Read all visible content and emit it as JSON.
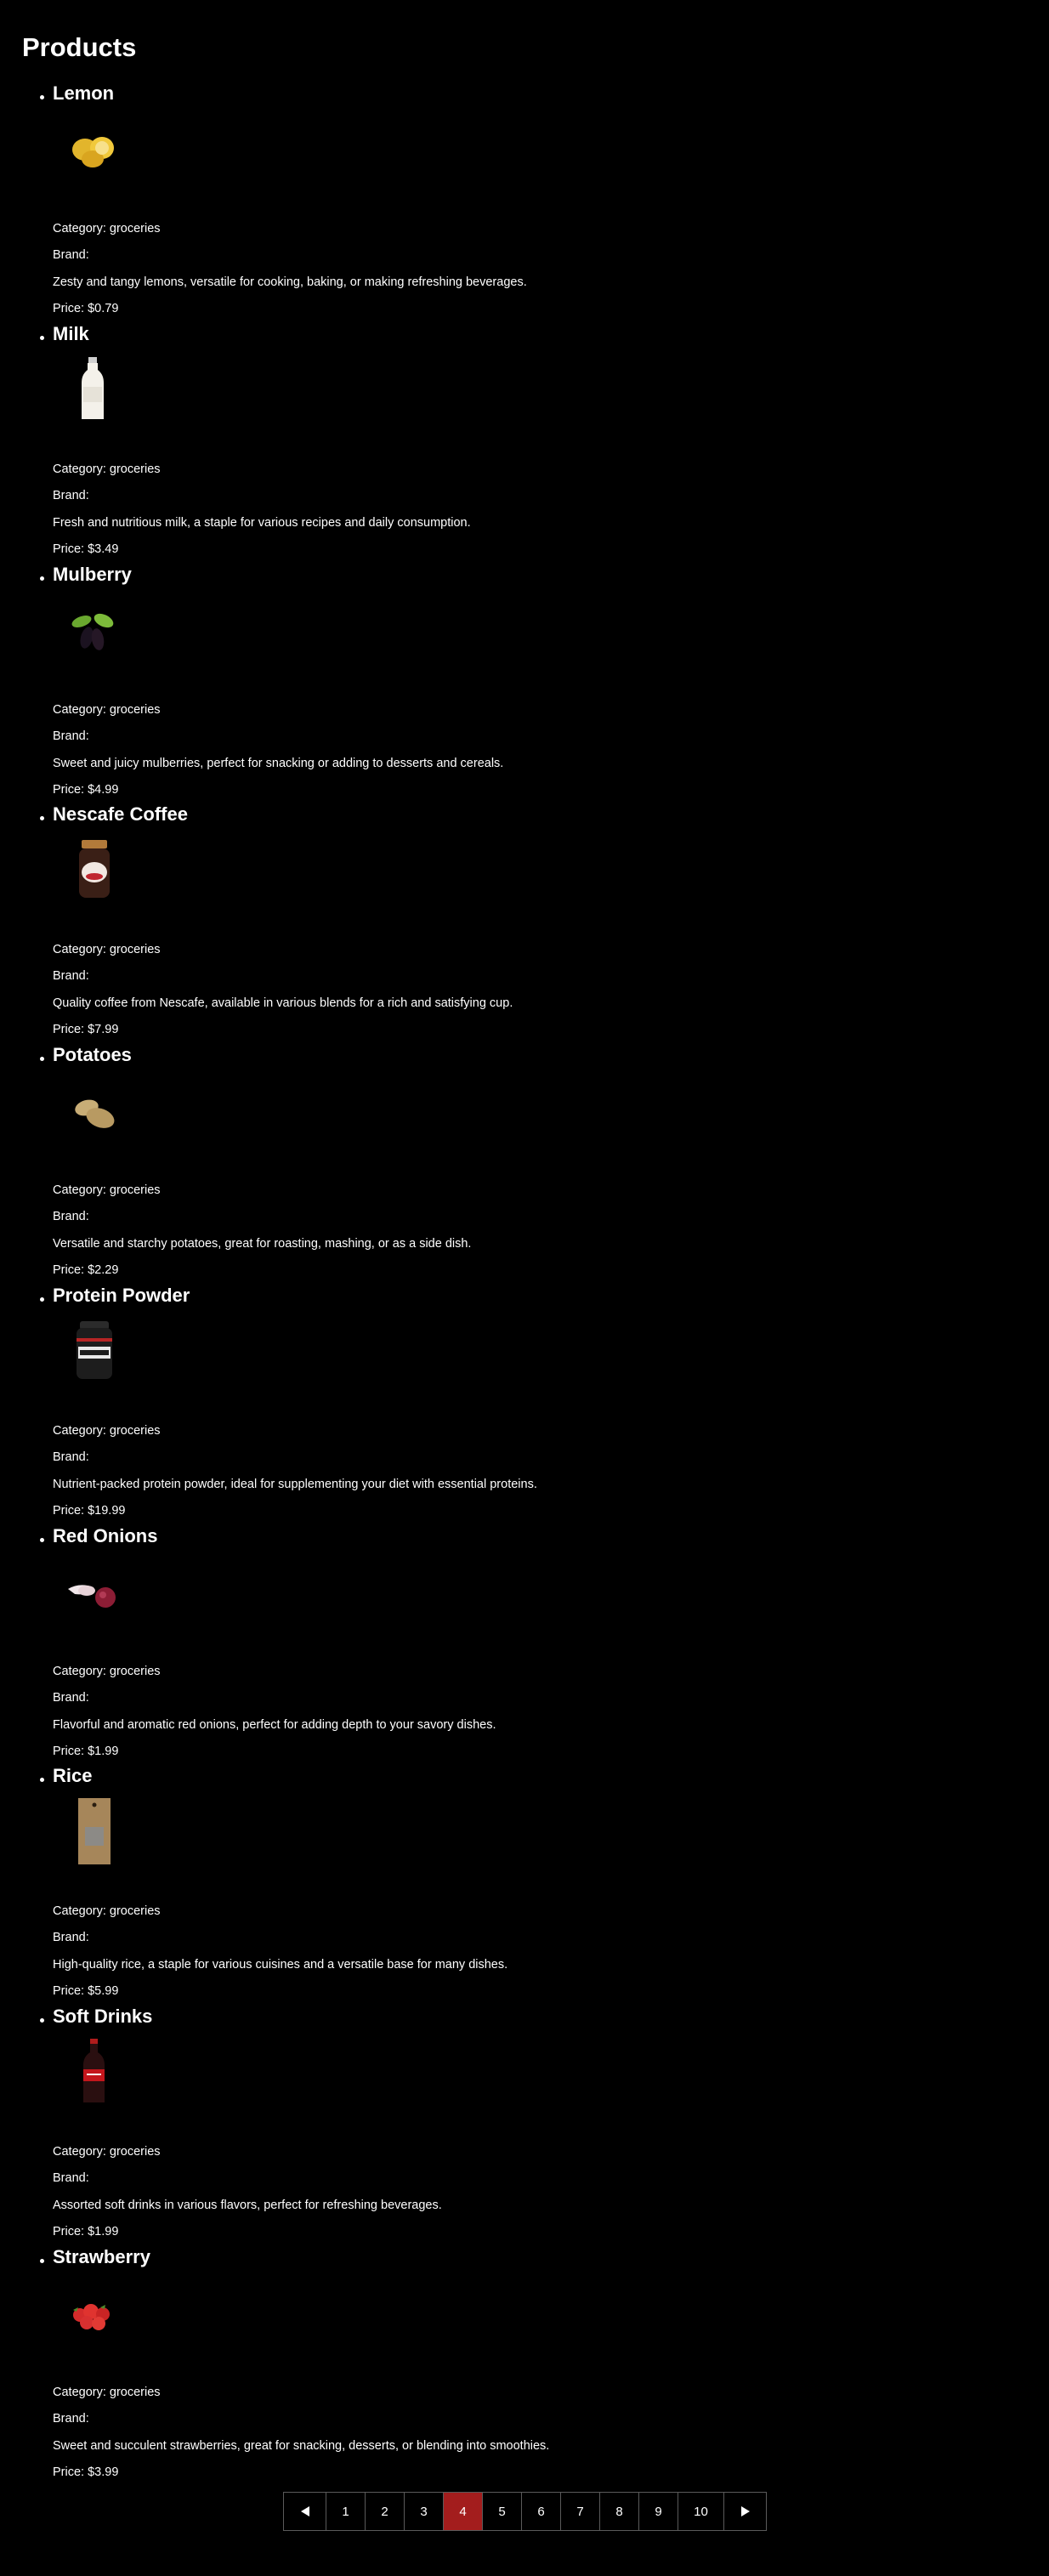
{
  "page": {
    "title": "Products"
  },
  "products": [
    {
      "name": "Lemon",
      "image": "lemon-image",
      "category": "Category: groceries",
      "brand": "Brand:",
      "description": "Zesty and tangy lemons, versatile for cooking, baking, or making refreshing beverages.",
      "price": "Price: $0.79"
    },
    {
      "name": "Milk",
      "image": "milk-bottle-image",
      "category": "Category: groceries",
      "brand": "Brand:",
      "description": "Fresh and nutritious milk, a staple for various recipes and daily consumption.",
      "price": "Price: $3.49"
    },
    {
      "name": "Mulberry",
      "image": "mulberry-image",
      "category": "Category: groceries",
      "brand": "Brand:",
      "description": "Sweet and juicy mulberries, perfect for snacking or adding to desserts and cereals.",
      "price": "Price: $4.99"
    },
    {
      "name": "Nescafe Coffee",
      "image": "coffee-jar-image",
      "category": "Category: groceries",
      "brand": "Brand:",
      "description": "Quality coffee from Nescafe, available in various blends for a rich and satisfying cup.",
      "price": "Price: $7.99"
    },
    {
      "name": "Potatoes",
      "image": "potatoes-image",
      "category": "Category: groceries",
      "brand": "Brand:",
      "description": "Versatile and starchy potatoes, great for roasting, mashing, or as a side dish.",
      "price": "Price: $2.29"
    },
    {
      "name": "Protein Powder",
      "image": "protein-tub-image",
      "category": "Category: groceries",
      "brand": "Brand:",
      "description": "Nutrient-packed protein powder, ideal for supplementing your diet with essential proteins.",
      "price": "Price: $19.99"
    },
    {
      "name": "Red Onions",
      "image": "red-onions-image",
      "category": "Category: groceries",
      "brand": "Brand:",
      "description": "Flavorful and aromatic red onions, perfect for adding depth to your savory dishes.",
      "price": "Price: $1.99"
    },
    {
      "name": "Rice",
      "image": "rice-bag-image",
      "category": "Category: groceries",
      "brand": "Brand:",
      "description": "High-quality rice, a staple for various cuisines and a versatile base for many dishes.",
      "price": "Price: $5.99"
    },
    {
      "name": "Soft Drinks",
      "image": "soda-bottle-image",
      "category": "Category: groceries",
      "brand": "Brand:",
      "description": "Assorted soft drinks in various flavors, perfect for refreshing beverages.",
      "price": "Price: $1.99"
    },
    {
      "name": "Strawberry",
      "image": "strawberries-image",
      "category": "Category: groceries",
      "brand": "Brand:",
      "description": "Sweet and succulent strawberries, great for snacking, desserts, or blending into smoothies.",
      "price": "Price: $3.99"
    }
  ],
  "pagination": {
    "prev_icon": "triangle-left-icon",
    "next_icon": "triangle-right-icon",
    "pages": [
      "1",
      "2",
      "3",
      "4",
      "5",
      "6",
      "7",
      "8",
      "9",
      "10"
    ],
    "current": "4",
    "active_color": "#a31d1d"
  }
}
